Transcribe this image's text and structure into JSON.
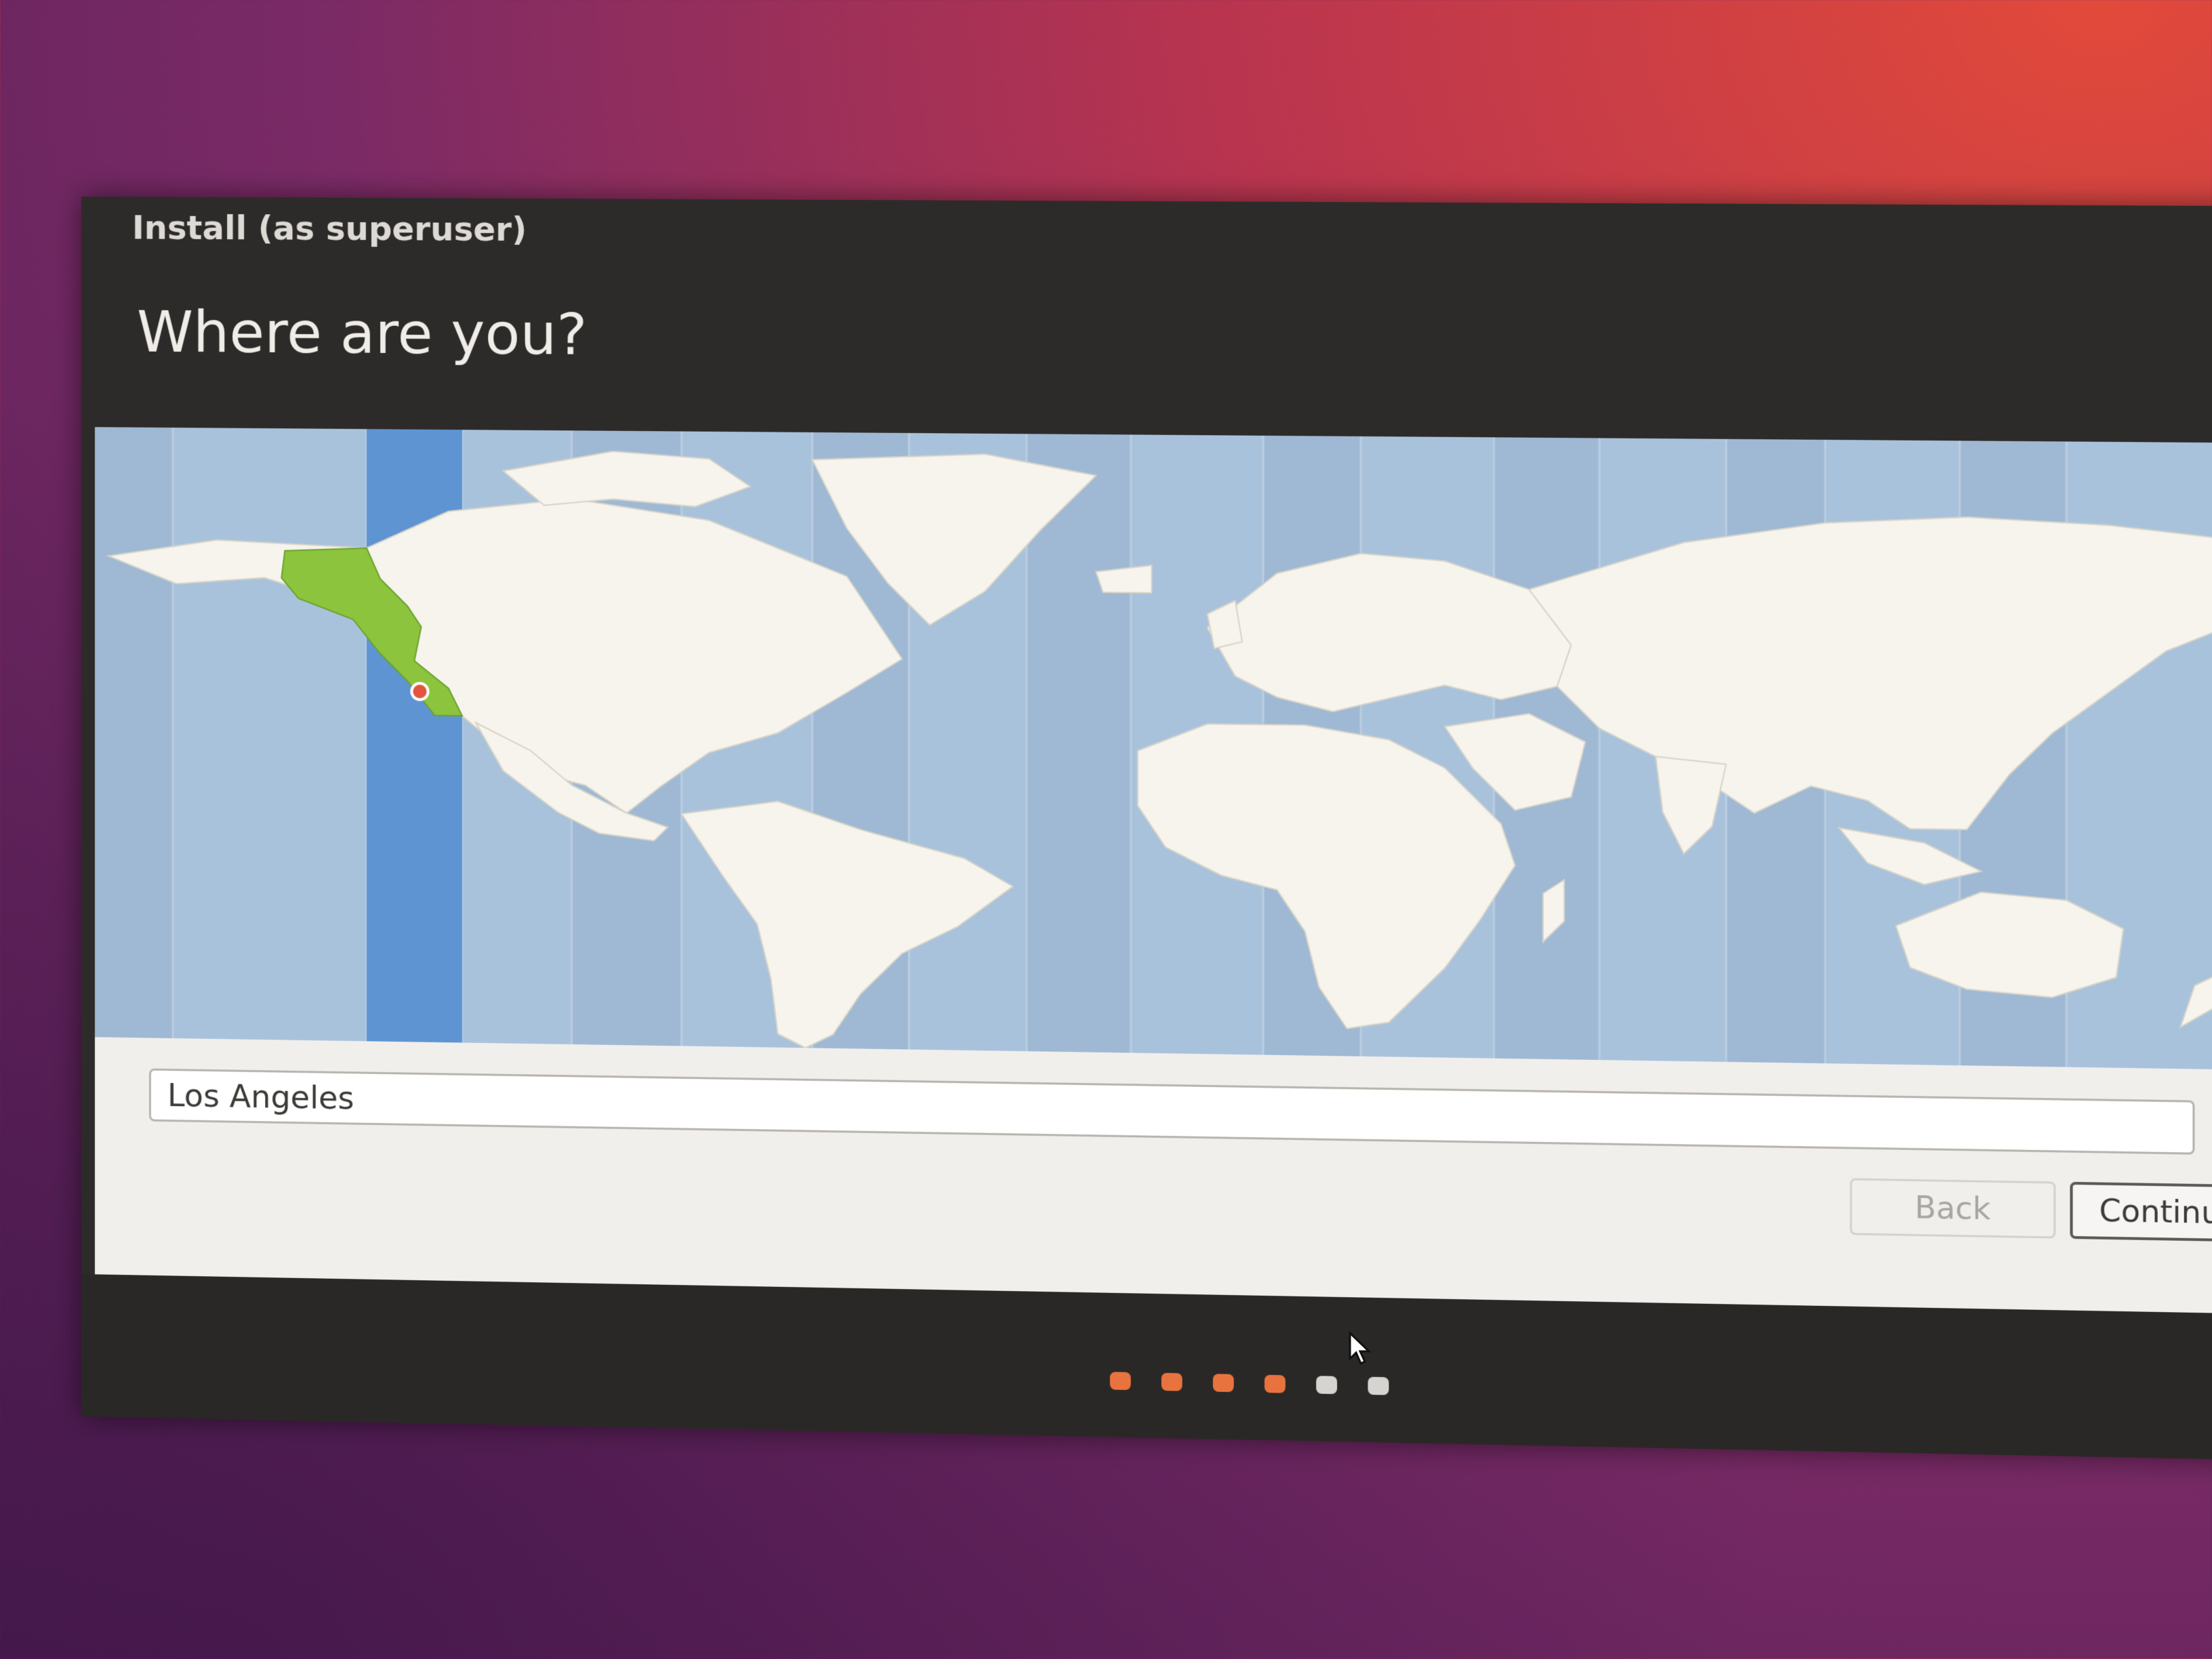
{
  "window": {
    "title": "Install (as superuser)",
    "heading": "Where are you?"
  },
  "timezone": {
    "search_value": "Los Angeles",
    "selected_city": "Los Angeles",
    "highlight_color": "#8cc43e",
    "marker_color": "#e3553e"
  },
  "buttons": {
    "back_label": "Back",
    "continue_label": "Continue"
  },
  "progress": {
    "total_steps": 6,
    "completed_steps": 4,
    "active_color": "#e9733e",
    "inactive_color": "#d6d4d0"
  },
  "icons": {
    "cursor": "mouse-pointer-icon",
    "location": "location-pin-icon"
  }
}
